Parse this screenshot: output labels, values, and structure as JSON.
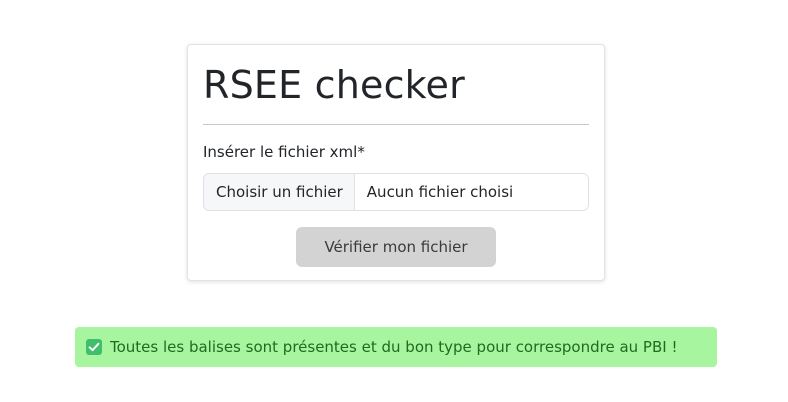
{
  "card": {
    "title": "RSEE checker",
    "field_label": "Insérer le fichier xml*",
    "file_input": {
      "button_label": "Choisir un fichier",
      "status_text": "Aucun fichier choisi"
    },
    "submit_label": "Vérifier mon fichier"
  },
  "alert": {
    "icon": "check-box-icon",
    "message": "Toutes les balises sont présentes et du bon type pour correspondre au PBI !",
    "colors": {
      "background": "#a8f5a0",
      "text": "#1f6b1f",
      "icon": "#3fbf6a"
    }
  },
  "colors": {
    "submit_background": "#d3d3d3"
  }
}
